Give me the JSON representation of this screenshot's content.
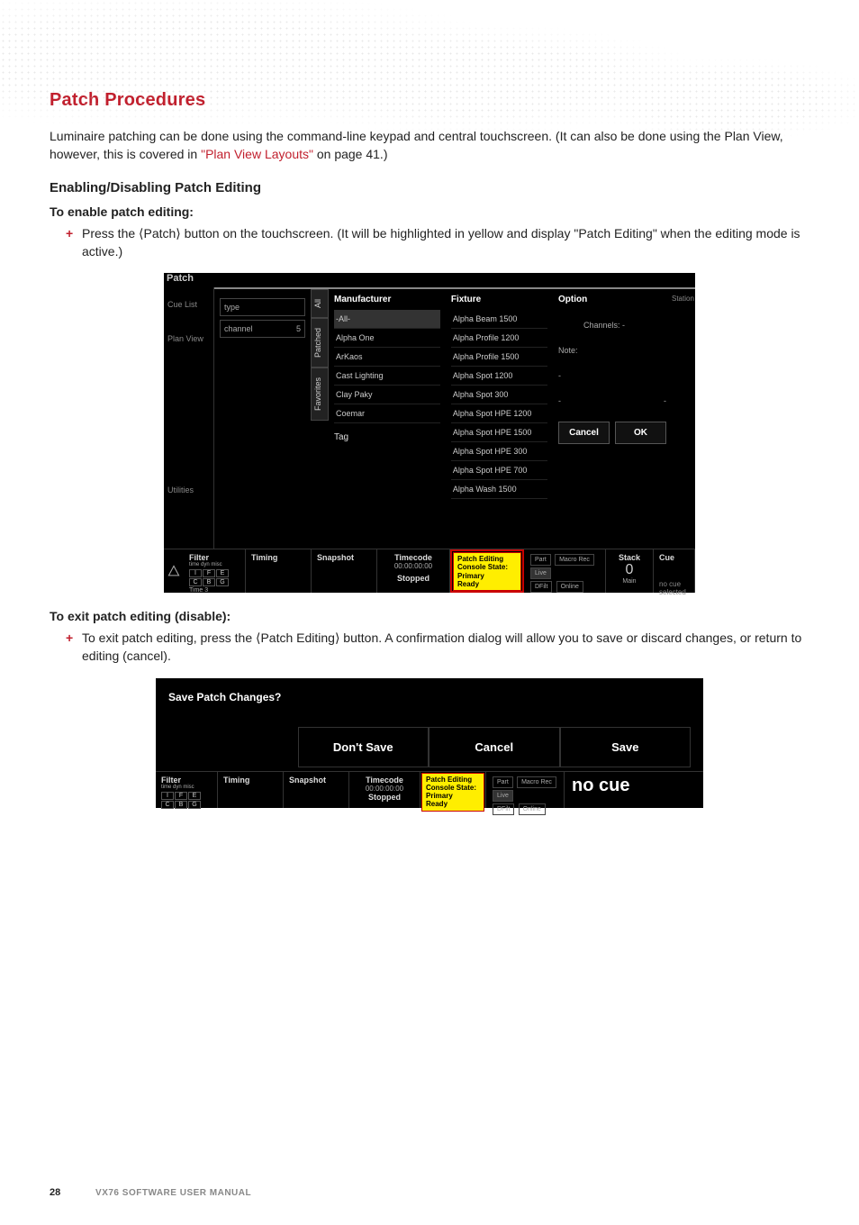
{
  "section_title": "Patch Procedures",
  "intro_a": "Luminaire patching can be done using the command-line keypad and central touchscreen. (It can also be done using the Plan View, however, this is covered in ",
  "intro_link": "\"Plan View Layouts\"",
  "intro_b": " on page 41.)",
  "sub_heading": "Enabling/Disabling Patch Editing",
  "enable_label": "To enable patch editing:",
  "enable_bullet": "Press the ⟨Patch⟩ button on the touchscreen. (It will be highlighted in yellow and display \"Patch Editing\" when the editing mode is active.)",
  "exit_label": "To exit patch editing (disable):",
  "exit_bullet": "To exit patch editing, press the ⟨Patch Editing⟩ button. A confirmation dialog will allow you to save or discard changes, or return to editing (cancel).",
  "page_number": "28",
  "manual_name": "VX76 SOFTWARE USER MANUAL",
  "shot1": {
    "nav": {
      "cue_list": "Cue List",
      "plan_view": "Plan View",
      "utilities": "Utilities"
    },
    "panel_title": "Patch",
    "left": {
      "type_label": "type",
      "type_value": "",
      "channel_label": "channel",
      "channel_value": "5"
    },
    "vtabs": {
      "all": "All",
      "patched": "Patched",
      "favorites": "Favorites"
    },
    "tag_label": "Tag",
    "cols": {
      "manufacturer": {
        "header": "Manufacturer",
        "rows": [
          "-All-",
          "Alpha One",
          "ArKaos",
          "Cast Lighting",
          "Clay Paky",
          "Coemar"
        ]
      },
      "fixture": {
        "header": "Fixture",
        "rows": [
          "Alpha Beam 1500",
          "Alpha Profile 1200",
          "Alpha Profile 1500",
          "Alpha Spot 1200",
          "Alpha Spot 300",
          "Alpha Spot HPE 1200",
          "Alpha Spot HPE 1500",
          "Alpha Spot HPE 300",
          "Alpha Spot HPE 700",
          "Alpha Wash 1500"
        ]
      },
      "option": {
        "header": "Option",
        "channels_label": "Channels:",
        "channels_value": "-",
        "note_label": "Note:",
        "cancel": "Cancel",
        "ok": "OK"
      }
    },
    "status": {
      "filter": "Filter",
      "filter_sub": "time dyn misc",
      "filter_cells": [
        "I",
        "F",
        "E",
        "C",
        "B",
        "G"
      ],
      "time_label": "Time",
      "time_value": "3",
      "timing": "Timing",
      "snapshot": "Snapshot",
      "timecode": "Timecode",
      "timecode_value": "00:00:00:00",
      "stopped": "Stopped",
      "yellow": {
        "l1": "Patch Editing",
        "l2": "Console State:",
        "l3": "Primary",
        "l4": "Ready"
      },
      "pills": {
        "part": "Part",
        "macro": "Macro Rec",
        "live": "Live",
        "dfilt": "DFilt",
        "online": "Online"
      },
      "stack": "Stack",
      "stack_val": "0",
      "main": "Main",
      "cue": "Cue",
      "no_cue": "no cue selected",
      "station": "Station"
    }
  },
  "shot2": {
    "question": "Save Patch Changes?",
    "buttons": {
      "dont_save": "Don't Save",
      "cancel": "Cancel",
      "save": "Save"
    },
    "nocue": "no cue"
  }
}
